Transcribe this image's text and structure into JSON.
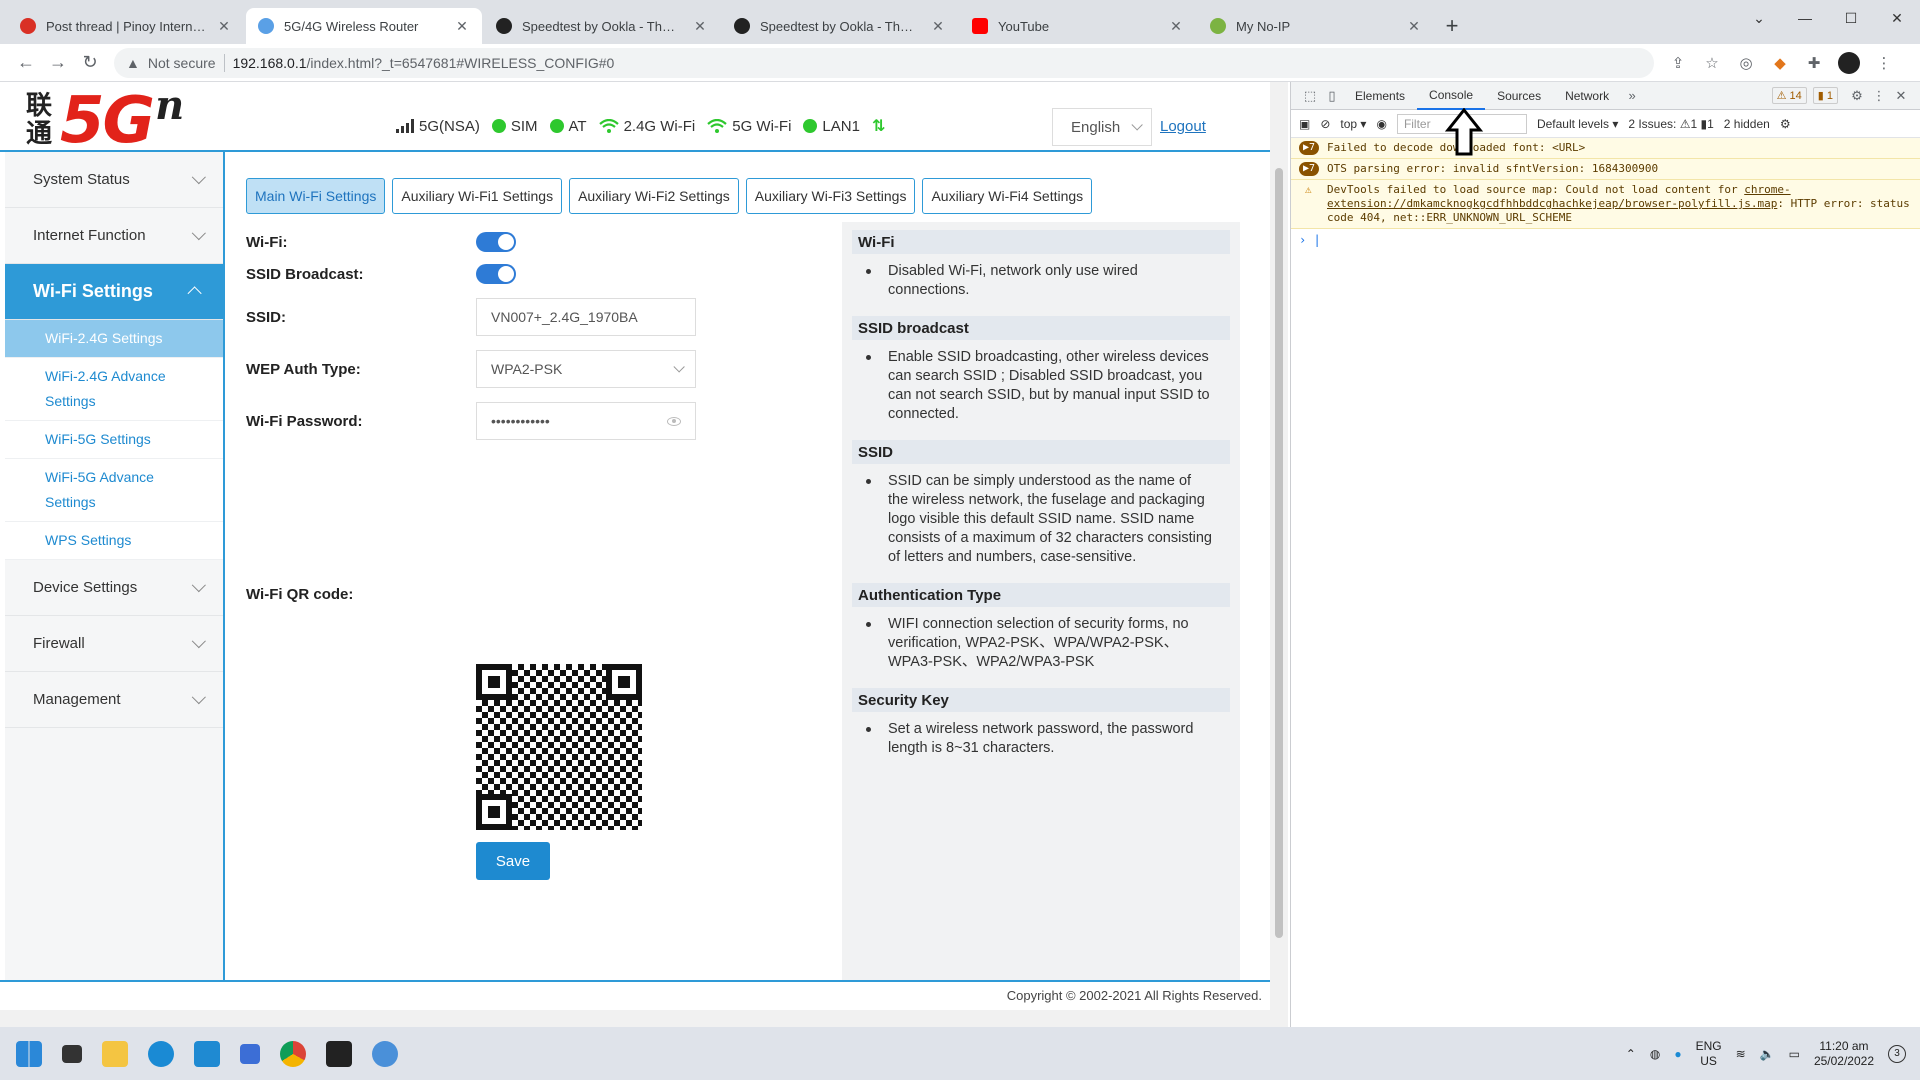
{
  "browser": {
    "tabs": [
      {
        "title": "Post thread | Pinoy Internet and",
        "fav": "#d93025",
        "active": false
      },
      {
        "title": "5G/4G Wireless Router",
        "fav": "#5aa0e6",
        "active": true
      },
      {
        "title": "Speedtest by Ookla - The Global",
        "fav": "#222222",
        "active": false
      },
      {
        "title": "Speedtest by Ookla - The Global",
        "fav": "#222222",
        "active": false
      },
      {
        "title": "YouTube",
        "fav": "#ff0000",
        "active": false
      },
      {
        "title": "My No-IP",
        "fav": "#7cb342",
        "active": false
      }
    ],
    "not_secure": "Not secure",
    "url_host": "192.168.0.1",
    "url_path": "/index.html?_t=6547681#WIRELESS_CONFIG#0"
  },
  "router": {
    "logo_cn_top": "联",
    "logo_cn_bottom": "通",
    "logo_big": "5G",
    "logo_sup": "n",
    "status": {
      "signal": "5G(NSA)",
      "sim": "SIM",
      "at": "AT",
      "wifi24": "2.4G Wi-Fi",
      "wifi5": "5G Wi-Fi",
      "lan": "LAN1"
    },
    "language": "English",
    "logout": "Logout",
    "sidebar": {
      "system_status": "System Status",
      "internet_function": "Internet Function",
      "wifi_settings": "Wi-Fi Settings",
      "items": [
        {
          "label": "WiFi-2.4G Settings"
        },
        {
          "label": "WiFi-2.4G Advance Settings"
        },
        {
          "label": "WiFi-5G Settings"
        },
        {
          "label": "WiFi-5G Advance Settings"
        },
        {
          "label": "WPS Settings"
        }
      ],
      "device_settings": "Device Settings",
      "firewall": "Firewall",
      "management": "Management"
    },
    "subtabs": [
      "Main Wi-Fi Settings",
      "Auxiliary Wi-Fi1 Settings",
      "Auxiliary Wi-Fi2 Settings",
      "Auxiliary Wi-Fi3 Settings",
      "Auxiliary Wi-Fi4 Settings"
    ],
    "form": {
      "wifi_label": "Wi-Fi:",
      "ssid_broadcast_label": "SSID Broadcast:",
      "ssid_label": "SSID:",
      "ssid_value": "VN007+_2.4G_1970BA",
      "auth_label": "WEP Auth Type:",
      "auth_value": "WPA2-PSK",
      "password_label": "Wi-Fi Password:",
      "password_value": "••••••••••••",
      "qr_label": "Wi-Fi QR code:",
      "save": "Save"
    },
    "help": [
      {
        "title": "Wi-Fi",
        "text": "Disabled Wi-Fi, network only use wired connections."
      },
      {
        "title": "SSID broadcast",
        "text": "Enable SSID broadcasting, other wireless devices can search SSID ; Disabled SSID broadcast, you can not search SSID, but by manual input SSID to connected."
      },
      {
        "title": "SSID",
        "text": "SSID can be simply understood as the name of the wireless network, the fuselage and packaging logo visible this default SSID name. SSID name consists of a maximum of 32 characters consisting of letters and numbers, case-sensitive."
      },
      {
        "title": "Authentication Type",
        "text": "WIFI connection selection of security forms, no verification, WPA2-PSK、WPA/WPA2-PSK、WPA3-PSK、WPA2/WPA3-PSK"
      },
      {
        "title": "Security Key",
        "text": "Set a wireless network password, the password length is 8~31 characters."
      }
    ],
    "copyright": "Copyright © 2002-2021 All Rights Reserved."
  },
  "devtools": {
    "tabs": [
      "Elements",
      "Console",
      "Sources",
      "Network"
    ],
    "warn_count": "14",
    "info_count": "1",
    "context": "top",
    "filter_placeholder": "Filter",
    "levels": "Default levels",
    "issues": "2 Issues:",
    "issues_warn": "1",
    "issues_info": "1",
    "hidden": "2 hidden",
    "messages": [
      {
        "count": "7",
        "text": "Failed to decode downloaded font: <URL>"
      },
      {
        "count": "7",
        "text": "OTS parsing error: invalid sfntVersion: 1684300900"
      }
    ],
    "sourcemap_msg_a": "DevTools failed to load source map: Could not load content for ",
    "sourcemap_link": "chrome-extension://dmkamcknogkgcdfhhbddcghachkejeap/browser-polyfill.js.map",
    "sourcemap_msg_b": ": HTTP error: status code 404, net::ERR_UNKNOWN_URL_SCHEME"
  },
  "taskbar": {
    "lang_top": "ENG",
    "lang_bottom": "US",
    "time": "11:20 am",
    "date": "25/02/2022",
    "notif_count": "3"
  }
}
